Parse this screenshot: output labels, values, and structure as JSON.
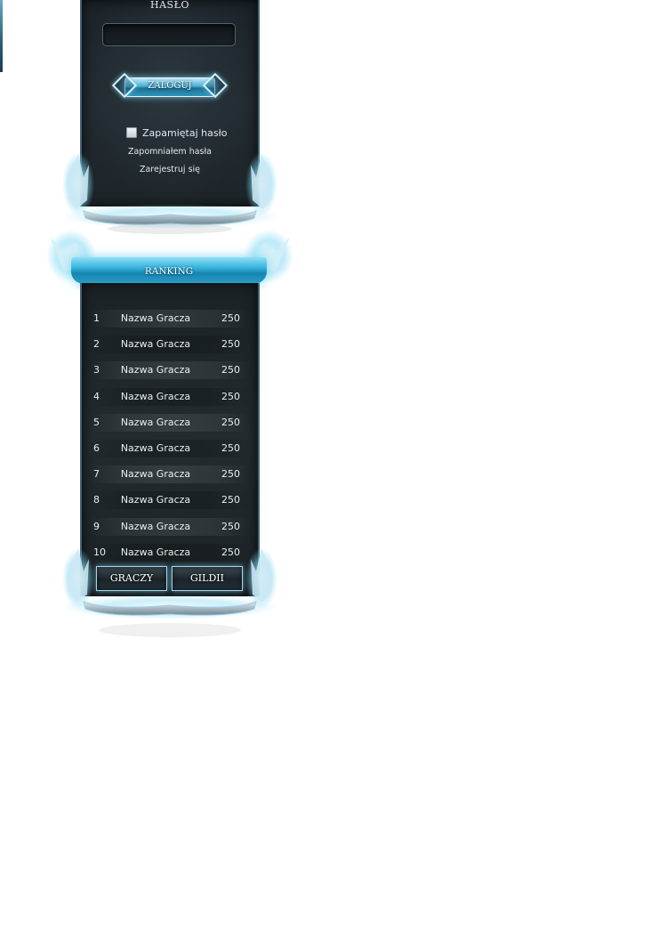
{
  "login": {
    "password_label": "HASŁO",
    "password_value": "",
    "login_button": "ZALOGUJ",
    "remember_label": "Zapamiętaj hasło",
    "remember_checked": false,
    "forgot_link": "Zapomniałem hasła",
    "register_link": "Zarejestruj się"
  },
  "ranking": {
    "title": "RANKING",
    "rows": [
      {
        "pos": "1",
        "name": "Nazwa Gracza",
        "score": "250"
      },
      {
        "pos": "2",
        "name": "Nazwa Gracza",
        "score": "250"
      },
      {
        "pos": "3",
        "name": "Nazwa Gracza",
        "score": "250"
      },
      {
        "pos": "4",
        "name": "Nazwa Gracza",
        "score": "250"
      },
      {
        "pos": "5",
        "name": "Nazwa Gracza",
        "score": "250"
      },
      {
        "pos": "6",
        "name": "Nazwa Gracza",
        "score": "250"
      },
      {
        "pos": "7",
        "name": "Nazwa Gracza",
        "score": "250"
      },
      {
        "pos": "8",
        "name": "Nazwa Gracza",
        "score": "250"
      },
      {
        "pos": "9",
        "name": "Nazwa Gracza",
        "score": "250"
      },
      {
        "pos": "10",
        "name": "Nazwa Gracza",
        "score": "250"
      }
    ],
    "tab_players": "GRACZY",
    "tab_guilds": "GILDII"
  },
  "colors": {
    "accent": "#37b2dc",
    "panel": "#1f272b",
    "frame": "#3f6377"
  }
}
